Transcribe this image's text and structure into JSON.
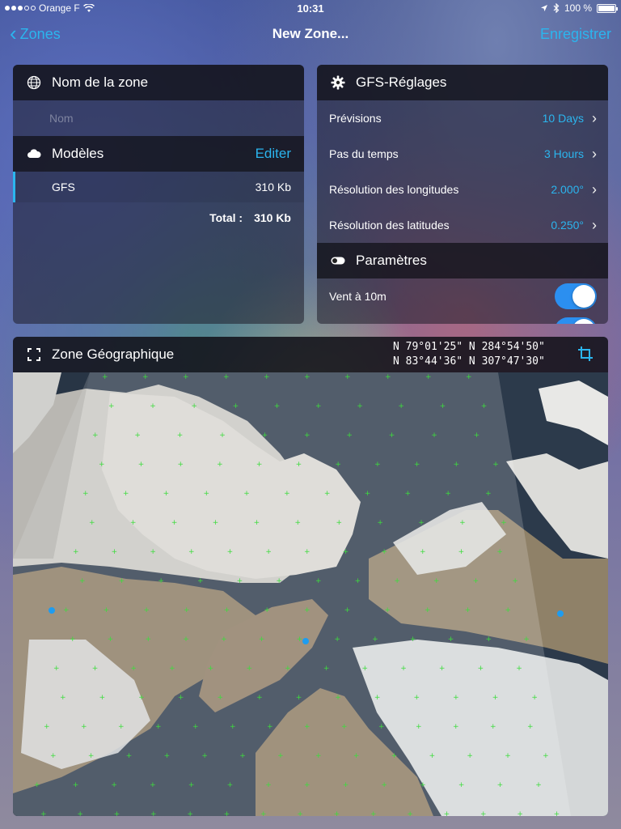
{
  "status": {
    "carrier": "Orange F",
    "time": "10:31",
    "battery": "100 %",
    "battery_level": 1.0,
    "icons": [
      "location-arrow-icon",
      "bluetooth-icon",
      "wifi-icon"
    ]
  },
  "nav": {
    "back_label": "Zones",
    "title": "New Zone...",
    "save_label": "Enregistrer"
  },
  "zone_name": {
    "header": "Nom de la zone",
    "input_placeholder": "Nom",
    "input_value": ""
  },
  "models": {
    "header": "Modèles",
    "edit_label": "Editer",
    "items": [
      {
        "name": "GFS",
        "size": "310 Kb"
      }
    ],
    "total_label": "Total :",
    "total_value": "310 Kb"
  },
  "gfs": {
    "header": "GFS-Réglages",
    "rows": [
      {
        "label": "Prévisions",
        "value": "10 Days"
      },
      {
        "label": "Pas du temps",
        "value": "3 Hours"
      },
      {
        "label": "Résolution des longitudes",
        "value": "2.000°"
      },
      {
        "label": "Résolution des latitudes",
        "value": "0.250°"
      }
    ]
  },
  "params": {
    "header": "Paramètres",
    "rows": [
      {
        "label": "Vent à 10m",
        "enabled": true
      }
    ]
  },
  "geo": {
    "header": "Zone Géographique",
    "coord_line1": "N 79°01'25\" N 284°54'50\"",
    "coord_line2": "N 83°44'36\" N 307°47'30\""
  },
  "colors": {
    "accent": "#2bb5ee",
    "toggle_on": "#2b8ff0",
    "grid_point": "#3ddc3d",
    "station_point": "#1e9cf0"
  }
}
